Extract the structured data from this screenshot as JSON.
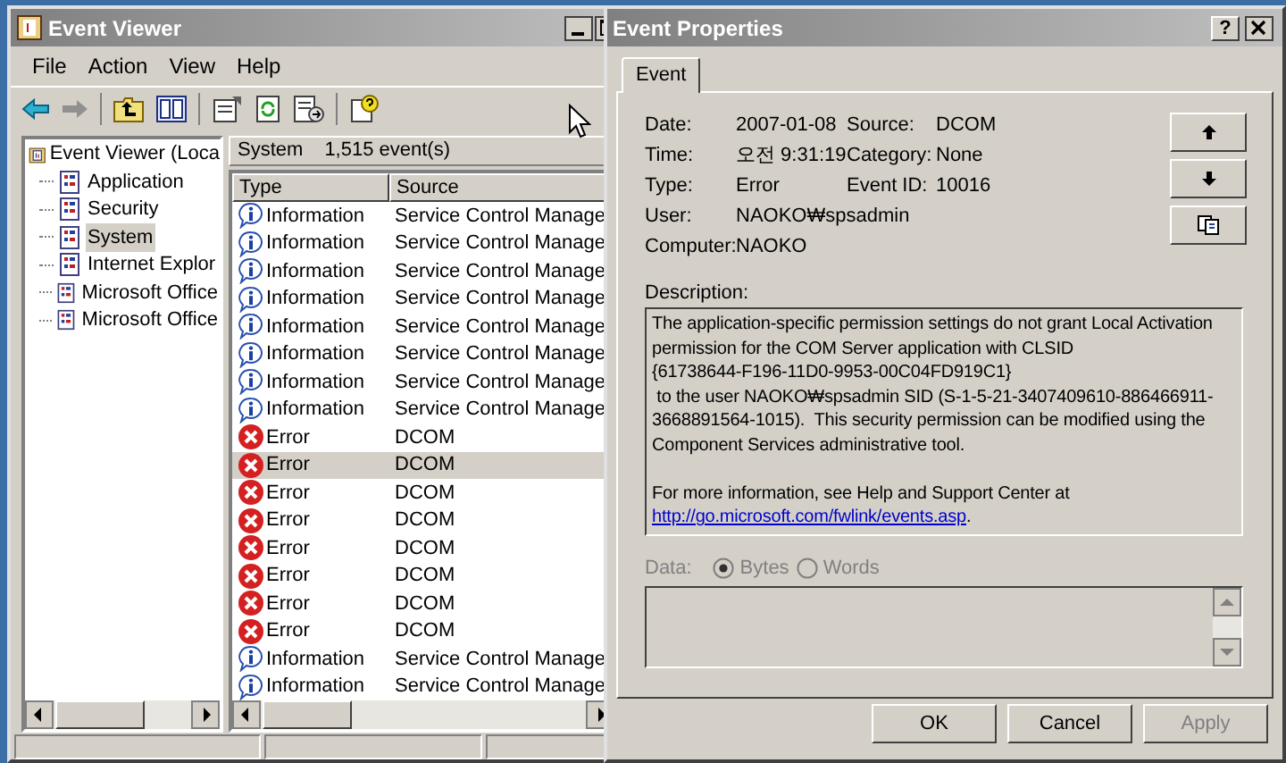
{
  "event_viewer": {
    "title": "Event Viewer",
    "menu": [
      "File",
      "Action",
      "View",
      "Help"
    ],
    "tree": {
      "label": "Event Viewer (Loca",
      "children": [
        {
          "label": "Application",
          "selected": false
        },
        {
          "label": "Security",
          "selected": false
        },
        {
          "label": "System",
          "selected": true
        },
        {
          "label": "Internet Explor",
          "selected": false
        },
        {
          "label": "Microsoft Office",
          "selected": false
        },
        {
          "label": "Microsoft Office",
          "selected": false
        }
      ]
    },
    "list_header": {
      "log": "System",
      "count": "1,515 event(s)"
    },
    "columns": [
      "Type",
      "Source"
    ],
    "rows": [
      {
        "kind": "information",
        "type": "Information",
        "source": "Service Control Manage",
        "selected": false
      },
      {
        "kind": "information",
        "type": "Information",
        "source": "Service Control Manage",
        "selected": false
      },
      {
        "kind": "information",
        "type": "Information",
        "source": "Service Control Manage",
        "selected": false
      },
      {
        "kind": "information",
        "type": "Information",
        "source": "Service Control Manage",
        "selected": false
      },
      {
        "kind": "information",
        "type": "Information",
        "source": "Service Control Manage",
        "selected": false
      },
      {
        "kind": "information",
        "type": "Information",
        "source": "Service Control Manage",
        "selected": false
      },
      {
        "kind": "information",
        "type": "Information",
        "source": "Service Control Manage",
        "selected": false
      },
      {
        "kind": "information",
        "type": "Information",
        "source": "Service Control Manage",
        "selected": false
      },
      {
        "kind": "error",
        "type": "Error",
        "source": "DCOM",
        "selected": false
      },
      {
        "kind": "error",
        "type": "Error",
        "source": "DCOM",
        "selected": true
      },
      {
        "kind": "error",
        "type": "Error",
        "source": "DCOM",
        "selected": false
      },
      {
        "kind": "error",
        "type": "Error",
        "source": "DCOM",
        "selected": false
      },
      {
        "kind": "error",
        "type": "Error",
        "source": "DCOM",
        "selected": false
      },
      {
        "kind": "error",
        "type": "Error",
        "source": "DCOM",
        "selected": false
      },
      {
        "kind": "error",
        "type": "Error",
        "source": "DCOM",
        "selected": false
      },
      {
        "kind": "error",
        "type": "Error",
        "source": "DCOM",
        "selected": false
      },
      {
        "kind": "information",
        "type": "Information",
        "source": "Service Control Manage",
        "selected": false
      },
      {
        "kind": "information",
        "type": "Information",
        "source": "Service Control Manage",
        "selected": false
      }
    ]
  },
  "event_properties": {
    "title": "Event Properties",
    "help_button": "?",
    "tabs": [
      {
        "label": "Event",
        "selected": true
      }
    ],
    "fields": [
      {
        "label": "Date:",
        "value": "2007-01-08"
      },
      {
        "label": "Time:",
        "value": "오전 9:31:19"
      },
      {
        "label": "Type:",
        "value": "Error"
      },
      {
        "label": "User:",
        "value": "NAOKO₩spsadmin"
      },
      {
        "label": "Computer:",
        "value": "NAOKO"
      }
    ],
    "fields_right": [
      {
        "label": "Source:",
        "value": "DCOM"
      },
      {
        "label": "Category:",
        "value": "None"
      },
      {
        "label": "Event ID:",
        "value": "10016"
      }
    ],
    "description_label": "Description:",
    "description": [
      "The application-specific permission settings do not grant Local Activation",
      "permission for the COM Server application with CLSID",
      "{61738644-F196-11D0-9953-00C04FD919C1}",
      " to the user NAOKO₩spsadmin SID (S-1-5-21-3407409610-886466911-",
      "3668891564-1015).  This security permission can be modified using the",
      "Component Services administrative tool."
    ],
    "more_info": "For more information, see Help and Support Center at",
    "link": "http://go.microsoft.com/fwlink/events.asp",
    "link_after": ".",
    "data": {
      "label": "Data:",
      "disabled": true,
      "options": [
        {
          "label": "Bytes",
          "selected": true
        },
        {
          "label": "Words",
          "selected": false
        }
      ]
    },
    "buttons": [
      {
        "label": "OK",
        "disabled": false
      },
      {
        "label": "Cancel",
        "disabled": false
      },
      {
        "label": "Apply",
        "disabled": true
      }
    ]
  }
}
